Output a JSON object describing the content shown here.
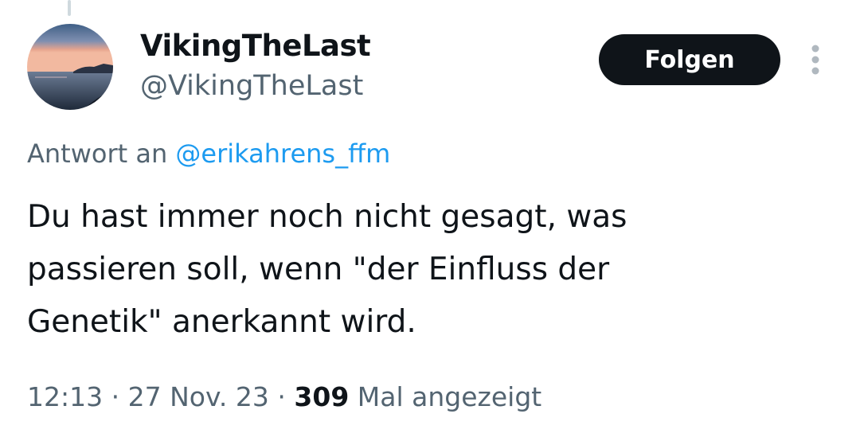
{
  "user": {
    "display_name": "VikingTheLast",
    "handle": "@VikingTheLast"
  },
  "follow_label": "Folgen",
  "reply": {
    "prefix": "Antwort an",
    "mention": "@erikahrens_ffm"
  },
  "tweet": {
    "text": "Du hast immer noch nicht gesagt, was\npassieren soll, wenn \"der Einfluss der\nGenetik\" anerkannt wird."
  },
  "meta": {
    "time": "12:13",
    "separator": "·",
    "date": "27 Nov. 23",
    "views": "309",
    "views_label": "Mal angezeigt"
  },
  "colors": {
    "text_primary": "#0f1419",
    "text_secondary": "#536471",
    "link": "#1d9bf0",
    "button_bg": "#0f1419"
  },
  "icons": {
    "avatar": "sunset-sea-avatar",
    "more": "more-vertical-icon"
  }
}
